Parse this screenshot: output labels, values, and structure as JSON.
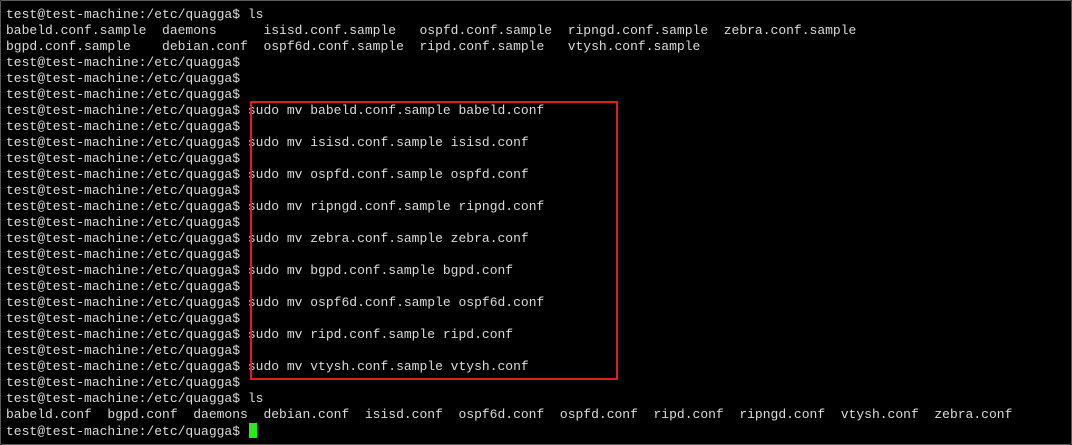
{
  "terminal": {
    "lines": [
      {
        "prompt": "test@test-machine:/etc/quagga$",
        "command": " ls"
      },
      {
        "output": "babeld.conf.sample  daemons      isisd.conf.sample   ospfd.conf.sample  ripngd.conf.sample  zebra.conf.sample"
      },
      {
        "output": "bgpd.conf.sample    debian.conf  ospf6d.conf.sample  ripd.conf.sample   vtysh.conf.sample"
      },
      {
        "prompt": "test@test-machine:/etc/quagga$",
        "command": ""
      },
      {
        "prompt": "test@test-machine:/etc/quagga$",
        "command": ""
      },
      {
        "prompt": "test@test-machine:/etc/quagga$",
        "command": ""
      },
      {
        "prompt": "test@test-machine:/etc/quagga$",
        "command": " sudo mv babeld.conf.sample babeld.conf"
      },
      {
        "prompt": "test@test-machine:/etc/quagga$",
        "command": ""
      },
      {
        "prompt": "test@test-machine:/etc/quagga$",
        "command": " sudo mv isisd.conf.sample isisd.conf"
      },
      {
        "prompt": "test@test-machine:/etc/quagga$",
        "command": ""
      },
      {
        "prompt": "test@test-machine:/etc/quagga$",
        "command": " sudo mv ospfd.conf.sample ospfd.conf"
      },
      {
        "prompt": "test@test-machine:/etc/quagga$",
        "command": ""
      },
      {
        "prompt": "test@test-machine:/etc/quagga$",
        "command": " sudo mv ripngd.conf.sample ripngd.conf"
      },
      {
        "prompt": "test@test-machine:/etc/quagga$",
        "command": ""
      },
      {
        "prompt": "test@test-machine:/etc/quagga$",
        "command": " sudo mv zebra.conf.sample zebra.conf"
      },
      {
        "prompt": "test@test-machine:/etc/quagga$",
        "command": ""
      },
      {
        "prompt": "test@test-machine:/etc/quagga$",
        "command": " sudo mv bgpd.conf.sample bgpd.conf"
      },
      {
        "prompt": "test@test-machine:/etc/quagga$",
        "command": ""
      },
      {
        "prompt": "test@test-machine:/etc/quagga$",
        "command": " sudo mv ospf6d.conf.sample ospf6d.conf"
      },
      {
        "prompt": "test@test-machine:/etc/quagga$",
        "command": ""
      },
      {
        "prompt": "test@test-machine:/etc/quagga$",
        "command": " sudo mv ripd.conf.sample ripd.conf"
      },
      {
        "prompt": "test@test-machine:/etc/quagga$",
        "command": ""
      },
      {
        "prompt": "test@test-machine:/etc/quagga$",
        "command": " sudo mv vtysh.conf.sample vtysh.conf"
      },
      {
        "prompt": "test@test-machine:/etc/quagga$",
        "command": ""
      },
      {
        "prompt": "test@test-machine:/etc/quagga$",
        "command": " ls"
      },
      {
        "output": "babeld.conf  bgpd.conf  daemons  debian.conf  isisd.conf  ospf6d.conf  ospfd.conf  ripd.conf  ripngd.conf  vtysh.conf  zebra.conf"
      },
      {
        "prompt": "test@test-machine:/etc/quagga$",
        "command": " ",
        "cursor": true
      }
    ]
  },
  "colors": {
    "background": "#000000",
    "text": "#dcdcdc",
    "cursor": "#2be81f",
    "highlight_border": "#e21b25"
  }
}
